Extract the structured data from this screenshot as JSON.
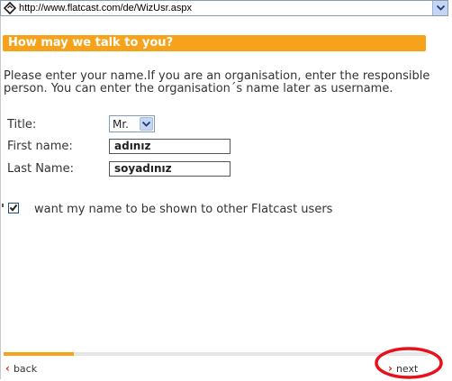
{
  "browser": {
    "address_url": "http://www.flatcast.com/de/WizUsr.aspx"
  },
  "page": {
    "section_title": "How may we talk to you?",
    "intro_text": "Please enter your name.If you are an organisation, enter the responsible person. You can enter the organisation´s name later as username."
  },
  "form": {
    "title_label": "Title:",
    "title_value": "Mr.",
    "first_name_label": "First name:",
    "first_name_value": "adınız",
    "last_name_label": "Last Name:",
    "last_name_value": "soyadınız",
    "show_name_checked": true,
    "show_name_label": "want my name to be shown to other Flatcast users"
  },
  "wizard": {
    "progress": 0.165,
    "back_label": "back",
    "next_label": "next"
  },
  "colors": {
    "accent": "#f7a21b",
    "annotation_circle": "#e8101a"
  }
}
